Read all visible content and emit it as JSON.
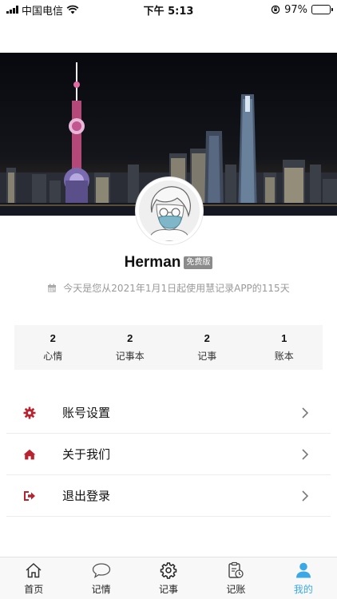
{
  "status_bar": {
    "carrier": "中国电信",
    "time": "下午 5:13",
    "battery": "97%",
    "battery_level": 0.97
  },
  "profile": {
    "username": "Herman",
    "plan_badge": "免费版",
    "usage_text": "今天是您从2021年1月1日起使用慧记录APP的115天"
  },
  "stats": [
    {
      "count": "2",
      "label": "心情"
    },
    {
      "count": "2",
      "label": "记事本"
    },
    {
      "count": "2",
      "label": "记事"
    },
    {
      "count": "1",
      "label": "账本"
    }
  ],
  "menu": [
    {
      "label": "账号设置",
      "icon": "gear-icon"
    },
    {
      "label": "关于我们",
      "icon": "home-icon"
    },
    {
      "label": "退出登录",
      "icon": "logout-icon"
    }
  ],
  "tabs": [
    {
      "label": "首页",
      "icon": "home-outline-icon",
      "active": false
    },
    {
      "label": "记情",
      "icon": "chat-bubble-icon",
      "active": false
    },
    {
      "label": "记事",
      "icon": "gear-outline-icon",
      "active": false
    },
    {
      "label": "记账",
      "icon": "ledger-clock-icon",
      "active": false
    },
    {
      "label": "我的",
      "icon": "person-icon",
      "active": true
    }
  ],
  "colors": {
    "menu_icon": "#b8232f",
    "tab_active": "#3ba8e6",
    "plan_badge": "#8b8b8b"
  }
}
